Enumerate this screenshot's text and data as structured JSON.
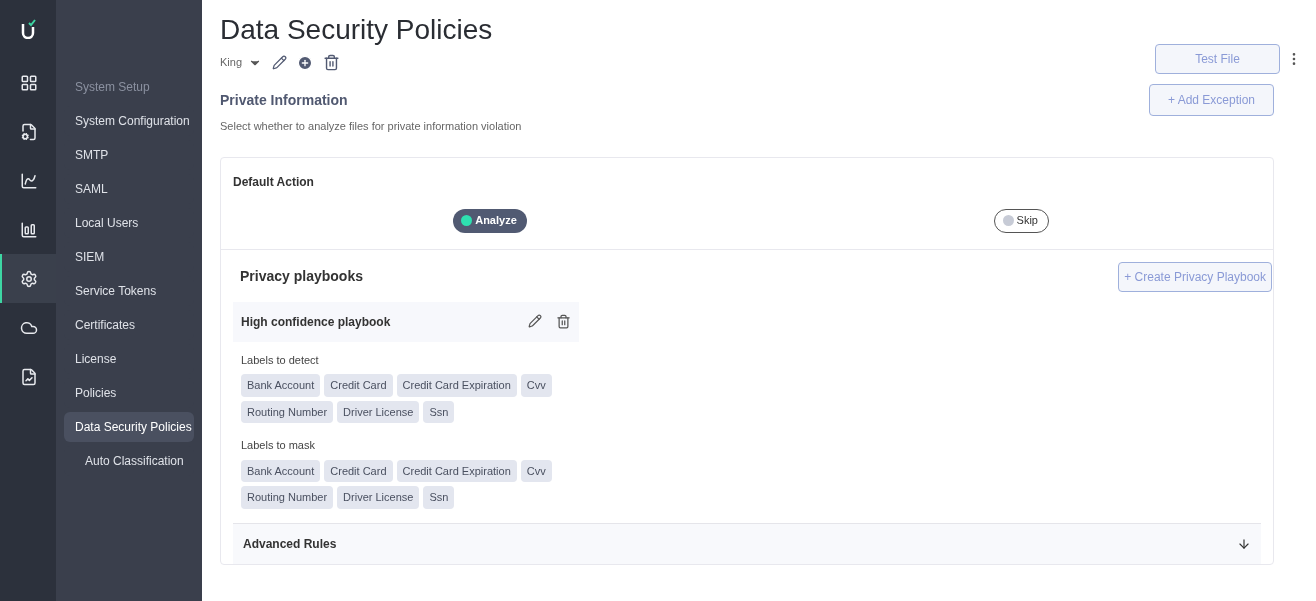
{
  "rail": [
    {
      "selected": false
    },
    {
      "selected": false
    },
    {
      "selected": false
    },
    {
      "selected": false
    },
    {
      "selected": true
    },
    {
      "selected": false
    },
    {
      "selected": false
    }
  ],
  "sidebar": {
    "heading": "System Setup",
    "items": [
      {
        "label": "System Configuration",
        "selected": false
      },
      {
        "label": "SMTP",
        "selected": false
      },
      {
        "label": "SAML",
        "selected": false
      },
      {
        "label": "Local Users",
        "selected": false
      },
      {
        "label": "SIEM",
        "selected": false
      },
      {
        "label": "Service Tokens",
        "selected": false
      },
      {
        "label": "Certificates",
        "selected": false
      },
      {
        "label": "License",
        "selected": false
      },
      {
        "label": "Policies",
        "selected": false
      },
      {
        "label": "Data Security Policies",
        "selected": true,
        "children": [
          {
            "label": "Auto Classification",
            "selected": false
          }
        ]
      }
    ]
  },
  "page": {
    "title": "Data Security Policies",
    "policy": "King",
    "test_button": "Test File"
  },
  "section": {
    "title": "Private Information",
    "description": "Select whether to analyze files for private information violation",
    "add_button": "+ Add Exception",
    "default_action": {
      "title": "Default Action",
      "options": [
        {
          "label": "Analyze",
          "selected": true
        },
        {
          "label": "Skip",
          "selected": false
        }
      ]
    },
    "playbooks": {
      "title": "Privacy playbooks",
      "create_button": "+ Create Privacy Playbook",
      "items": [
        {
          "name": "High confidence playbook",
          "groups": [
            {
              "title": "Labels to detect",
              "labels": [
                "Bank Account",
                "Credit Card",
                "Credit Card Expiration",
                "Cvv",
                "Routing Number",
                "Driver License",
                "Ssn"
              ]
            },
            {
              "title": "Labels to mask",
              "labels": [
                "Bank Account",
                "Credit Card",
                "Credit Card Expiration",
                "Cvv",
                "Routing Number",
                "Driver License",
                "Ssn"
              ]
            }
          ]
        }
      ]
    },
    "advanced": {
      "title": "Advanced Rules",
      "expanded": false
    }
  }
}
